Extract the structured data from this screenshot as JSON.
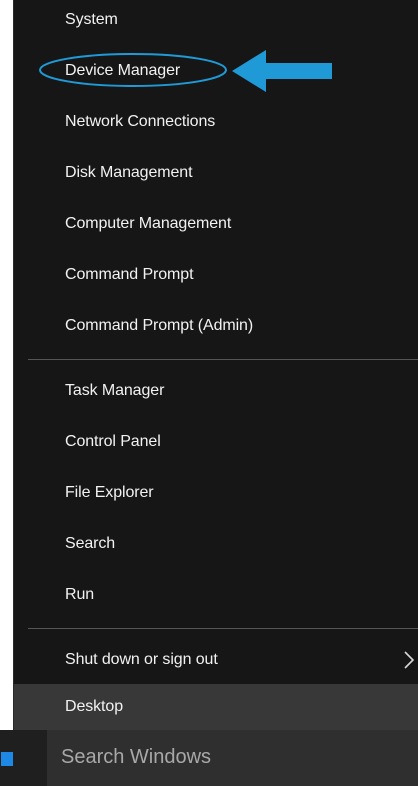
{
  "menu": {
    "group1": [
      {
        "label": "System"
      },
      {
        "label": "Device Manager"
      },
      {
        "label": "Network Connections"
      },
      {
        "label": "Disk Management"
      },
      {
        "label": "Computer Management"
      },
      {
        "label": "Command Prompt"
      },
      {
        "label": "Command Prompt (Admin)"
      }
    ],
    "group2": [
      {
        "label": "Task Manager"
      },
      {
        "label": "Control Panel"
      },
      {
        "label": "File Explorer"
      },
      {
        "label": "Search"
      },
      {
        "label": "Run"
      }
    ],
    "group3": [
      {
        "label": "Shut down or sign out",
        "has_submenu": true
      },
      {
        "label": "Desktop",
        "highlighted": true
      }
    ]
  },
  "annotation": {
    "target": "Device Manager",
    "color": "#1f9ad6"
  },
  "taskbar": {
    "search_placeholder": "Search Windows",
    "accent_color": "#1e88e5"
  },
  "colors": {
    "menu_background": "#161616",
    "menu_text": "#f2f2f2",
    "highlight_background": "#383838",
    "separator": "#555555"
  }
}
